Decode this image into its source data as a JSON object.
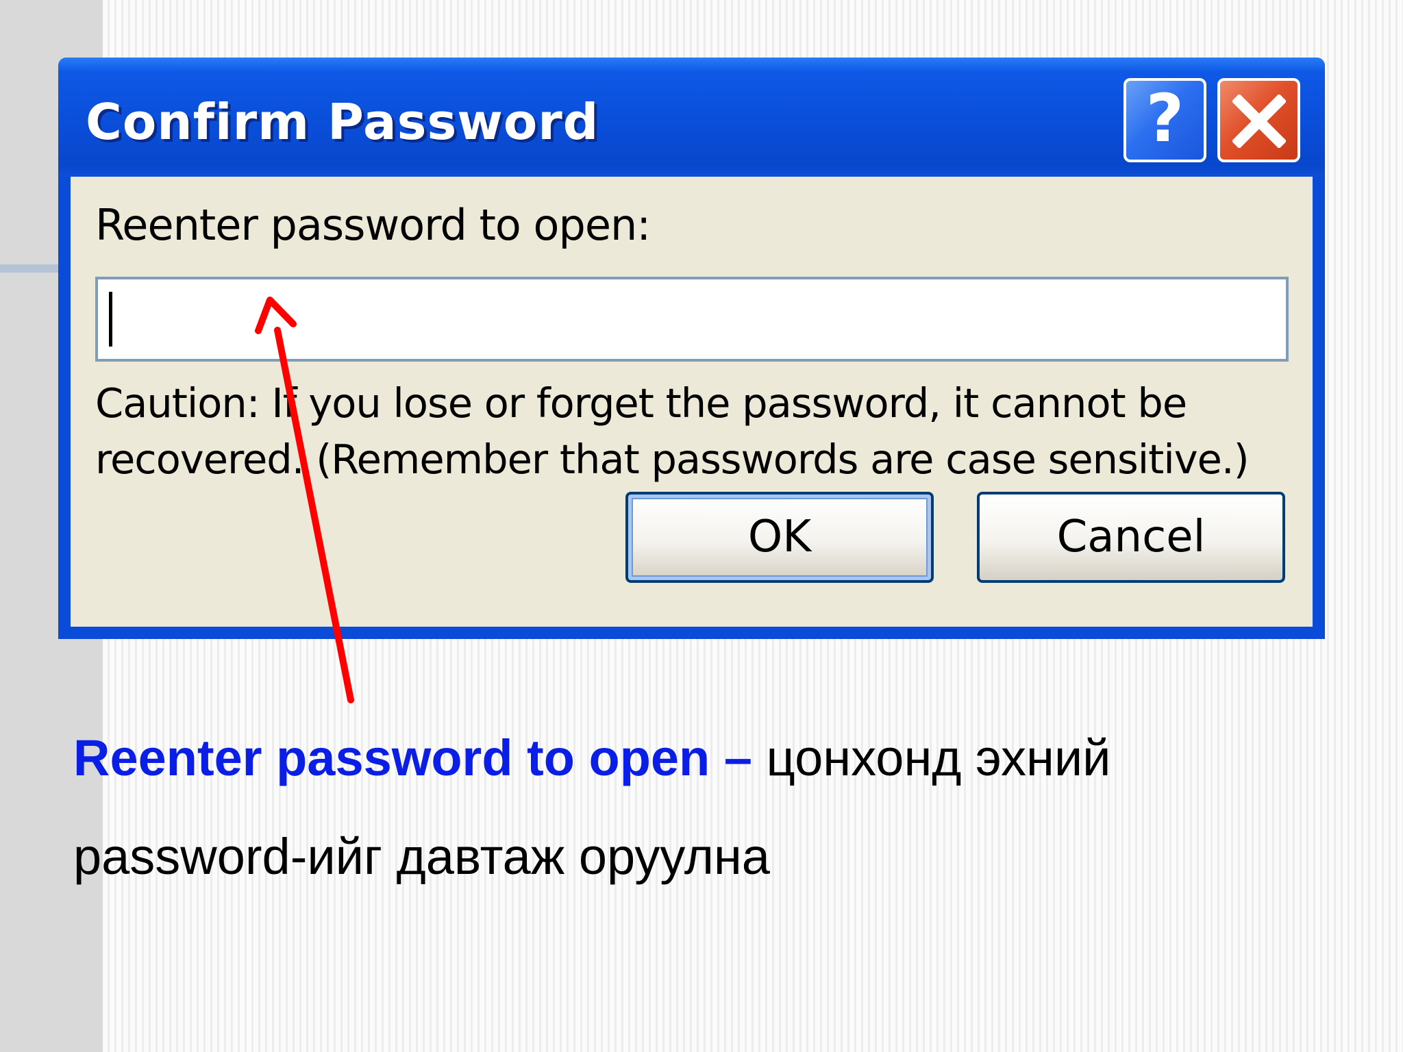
{
  "dialog": {
    "title": "Confirm Password",
    "help_button_label": "?",
    "prompt_label": "Reenter password to open:",
    "password_value": "",
    "caution_text": "Caution: If you lose or forget the password, it cannot be recovered. (Remember that passwords are case sensitive.)",
    "ok_label": "OK",
    "cancel_label": "Cancel",
    "icons": {
      "help": "question-mark-icon",
      "close": "close-x-icon"
    },
    "colors": {
      "titlebar": "#0a4ed9",
      "close_button": "#e0502a",
      "client_area": "#ece9d8"
    }
  },
  "annotation": {
    "arrow_color": "#ff0000"
  },
  "caption": {
    "term": "Reenter password to open –",
    "description": " цонхонд эхний password-ийг давтаж оруулна",
    "term_color": "#0a1ee6"
  }
}
